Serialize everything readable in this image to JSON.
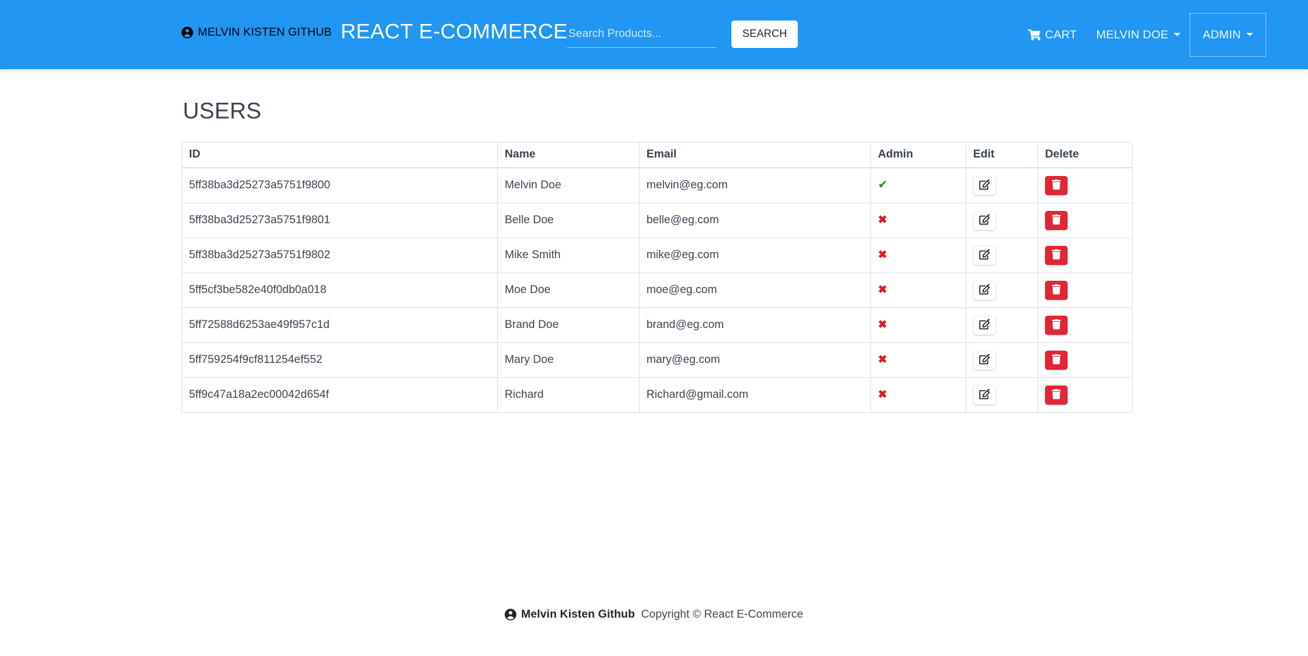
{
  "theme": {
    "header_bg": "#2196f3",
    "delete_btn": "#e32636",
    "admin_yes": "#1b8a1b",
    "admin_no": "#e8161d",
    "table_border": "#dee2e6"
  },
  "header": {
    "github_label": "MELVIN KISTEN GITHUB",
    "github_icon": "person-circle-icon",
    "brand_title": "REACT E-COMMERCE",
    "search": {
      "placeholder": "Search Products...",
      "value": "",
      "button_label": "SEARCH"
    },
    "nav": [
      {
        "label": "CART",
        "icon": "shopping-cart-icon",
        "caret": false,
        "focused": false
      },
      {
        "label": "MELVIN DOE",
        "icon": "",
        "caret": true,
        "focused": false
      },
      {
        "label": "ADMIN",
        "icon": "",
        "caret": true,
        "focused": true
      }
    ]
  },
  "main": {
    "page_title": "USERS",
    "table": {
      "columns": [
        "ID",
        "Name",
        "Email",
        "Admin",
        "Edit",
        "Delete"
      ],
      "edit_icon": "pencil-square-icon",
      "delete_icon": "trash-icon",
      "admin_true_icon": "check-icon",
      "admin_false_icon": "times-icon",
      "rows": [
        {
          "id": "5ff38ba3d25273a5751f9800",
          "name": "Melvin Doe",
          "email": "melvin@eg.com",
          "admin": true
        },
        {
          "id": "5ff38ba3d25273a5751f9801",
          "name": "Belle Doe",
          "email": "belle@eg.com",
          "admin": false
        },
        {
          "id": "5ff38ba3d25273a5751f9802",
          "name": "Mike Smith",
          "email": "mike@eg.com",
          "admin": false
        },
        {
          "id": "5ff5cf3be582e40f0db0a018",
          "name": "Moe Doe",
          "email": "moe@eg.com",
          "admin": false
        },
        {
          "id": "5ff72588d6253ae49f957c1d",
          "name": "Brand Doe",
          "email": "brand@eg.com",
          "admin": false
        },
        {
          "id": "5ff759254f9cf811254ef552",
          "name": "Mary Doe",
          "email": "mary@eg.com",
          "admin": false
        },
        {
          "id": "5ff9c47a18a2ec00042d654f",
          "name": "Richard",
          "email": "Richard@gmail.com",
          "admin": false
        }
      ]
    }
  },
  "footer": {
    "icon": "person-circle-icon",
    "name": "Melvin Kisten Github",
    "copyright": "Copyright © React E-Commerce"
  }
}
